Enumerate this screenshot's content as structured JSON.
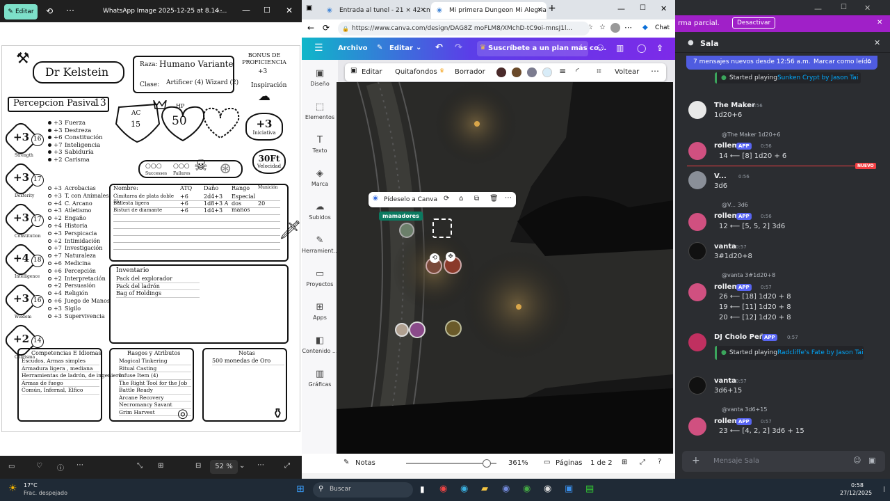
{
  "photos": {
    "edit_label": "Editar",
    "title": "WhatsApp Image 2025-12-25 at 8.14....",
    "zoom": "52 %",
    "sheet": {
      "name": "Dr Kelstein",
      "race_label": "Raza:",
      "race": "Humano Variante",
      "class_label": "Clase:",
      "class": "Artificer (4) Wizard (2)",
      "prof_title": "BONUS DE PROFICIENCIA",
      "prof_value": "+3",
      "inspiration": "Inspiración",
      "passive_label": "Percepcion Pasiva",
      "passive_value": "13",
      "ac_label": "AC",
      "ac_value": "15",
      "hp_label": "HP",
      "hp_value": "50",
      "initiative_value": "+3",
      "initiative_label": "Iniciativa",
      "speed_value": "30Ft",
      "speed_label": "Velocidad",
      "successes": "Successes",
      "failures": "Failures",
      "abilities": [
        {
          "mod": "+3",
          "score": "16",
          "label": "Strength"
        },
        {
          "mod": "+3",
          "score": "17",
          "label": "Dexterity"
        },
        {
          "mod": "+3",
          "score": "17",
          "label": "Constitution"
        },
        {
          "mod": "+4",
          "score": "18",
          "label": "Intelligence"
        },
        {
          "mod": "+3",
          "score": "16",
          "label": "Wisdom"
        },
        {
          "mod": "+2",
          "score": "14",
          "label": "Charisma"
        }
      ],
      "saves": [
        {
          "mod": "+3",
          "label": "Fuerza"
        },
        {
          "mod": "+3",
          "label": "Destreza"
        },
        {
          "mod": "+6",
          "label": "Constitución"
        },
        {
          "mod": "+7",
          "label": "Inteligencia"
        },
        {
          "mod": "+3",
          "label": "Sabiduría"
        },
        {
          "mod": "+2",
          "label": "Carisma"
        }
      ],
      "skills": [
        {
          "mod": "+3",
          "label": "Acrobacias"
        },
        {
          "mod": "+3",
          "label": "T. con Animales"
        },
        {
          "mod": "+4",
          "label": "C. Arcano"
        },
        {
          "mod": "+3",
          "label": "Atletismo"
        },
        {
          "mod": "+2",
          "label": "Engaño"
        },
        {
          "mod": "+4",
          "label": "Historia"
        },
        {
          "mod": "+3",
          "label": "Perspicacia"
        },
        {
          "mod": "+2",
          "label": "Intimidación"
        },
        {
          "mod": "+7",
          "label": "Investigación"
        },
        {
          "mod": "+7",
          "label": "Naturaleza"
        },
        {
          "mod": "+6",
          "label": "Medicina"
        },
        {
          "mod": "+6",
          "label": "Percepción"
        },
        {
          "mod": "+2",
          "label": "Interpretación"
        },
        {
          "mod": "+2",
          "label": "Persuasión"
        },
        {
          "mod": "+4",
          "label": "Religión"
        },
        {
          "mod": "+6",
          "label": "Juego de Manos"
        },
        {
          "mod": "+3",
          "label": "Sigilo"
        },
        {
          "mod": "+3",
          "label": "Supervivencia"
        }
      ],
      "attack_headers": [
        "Nombre:",
        "ATQ",
        "Daño",
        "Rango",
        "Munición"
      ],
      "attacks": [
        {
          "name": "Cimitarra de plata doble filo",
          "atq": "+6",
          "dmg": "2d4+3",
          "range": "Especial",
          "ammo": ""
        },
        {
          "name": "Ballesta ligera",
          "atq": "+6",
          "dmg": "1d8+3 A",
          "range": "dos manos",
          "ammo": "20"
        },
        {
          "name": "Bisturí de diamante",
          "atq": "+6",
          "dmg": "1d4+3",
          "range": "",
          "ammo": ""
        }
      ],
      "inventory_title": "Inventario",
      "inventory": [
        "Pack del explorador",
        "Pack del ladrón",
        "Bag of Holdings"
      ],
      "prof_lang_title": "Competencias E Idiomas",
      "prof_lang": [
        "Escudos, Armas simples",
        "Armadura ligera , mediana",
        "Herramientas de ladrón, de ingeniero",
        "Armas de fuego",
        "Común, Infernal, Elfico"
      ],
      "feats_title": "Rasgos y Atributos",
      "feats": [
        "Magical Tinkering",
        "Ritual Casting",
        "Infuse Item (4)",
        "The Right Tool for the Job",
        "Battle Ready",
        "Arcane Recovery",
        "Necromancy Savant",
        "Grim Harvest"
      ],
      "notes_title": "Notas",
      "notes": [
        "500 monedas de Oro"
      ]
    }
  },
  "browser": {
    "tab1": "Entrada al tunel - 21 × 42 cm",
    "tab2": "Mi primera Dungeon Mi Alegria - ",
    "url": "https://www.canva.com/design/DAG8Z moFLM8/XMchD-tC9oi-mnsJ1l...",
    "chat": "Chat",
    "canva": {
      "archivo": "Archivo",
      "editar": "Editar",
      "subscribe": "Suscríbete a un plan más co...",
      "side": [
        "Diseño",
        "Elementos",
        "Texto",
        "Marca",
        "Subidos",
        "Herramient...",
        "Proyectos",
        "Apps",
        "Contenido ...",
        "Gráficas"
      ],
      "toolbar": {
        "editar": "Editar",
        "quitafondos": "Quitafondos",
        "borrador": "Borrador",
        "voltear": "Voltear"
      },
      "swatches": [
        "#4a2a2a",
        "#6b4a2a",
        "#7b7b8f",
        "#d8ecf8"
      ],
      "popup": "Pídeselo a Canva",
      "tag": "mamadores",
      "notas": "Notas",
      "zoom": "361%",
      "paginas": "Páginas",
      "page": "1 de 2"
    }
  },
  "discord": {
    "notice_text": "rma parcial.",
    "notice_button": "Desactivar",
    "channel": "Sala",
    "newbar": "7 mensajes nuevos desde 12:56 a.m.",
    "mark_read": "Marcar como leído",
    "nuevo": "NUEVO",
    "messages": {
      "m0": {
        "prefix": "Started playing ",
        "link": "Sunken Crypt by Jason Tai"
      },
      "m1": {
        "name": "The Maker",
        "time": "0:56",
        "text": "1d20+6"
      },
      "m2": {
        "reply": "@The Maker 1d20+6",
        "name": "rollem",
        "app": "APP",
        "time": "0:56",
        "roll": "14  ⟵ [8] 1d20 + 6"
      },
      "m3": {
        "name": "V...",
        "time": "0:56",
        "text": "3d6"
      },
      "m4": {
        "reply": "@V... 3d6",
        "name": "rollem",
        "app": "APP",
        "time": "0:56",
        "roll": "12  ⟵ [5, 5, 2] 3d6"
      },
      "m5": {
        "name": "vanta",
        "time": "0:57",
        "text": "3#1d20+8"
      },
      "m6": {
        "reply": "@vanta 3#1d20+8",
        "name": "rollem",
        "app": "APP",
        "time": "0:57",
        "rolls": [
          "26  ⟵ [18] 1d20 + 8",
          "19  ⟵ [11] 1d20 + 8",
          "20  ⟵ [12] 1d20 + 8"
        ]
      },
      "m7": {
        "name": "DJ Cholo Peña",
        "app": "APP",
        "time": "0:57",
        "prefix": "Started playing ",
        "link": "Radcliffe's Fate by Jason Tai"
      },
      "m8": {
        "name": "vanta",
        "time": "0:57",
        "text": "3d6+15"
      },
      "m9": {
        "reply": "@vanta 3d6+15",
        "name": "rollem",
        "app": "APP",
        "time": "0:57",
        "roll": "23  ⟵ [4, 2, 2] 3d6 + 15"
      }
    },
    "input_placeholder": "Mensaje Sala"
  },
  "taskbar": {
    "temp": "17°C",
    "weather": "Frac. despejado",
    "search": "Buscar",
    "time": "0:58",
    "date": "27/12/2025"
  }
}
